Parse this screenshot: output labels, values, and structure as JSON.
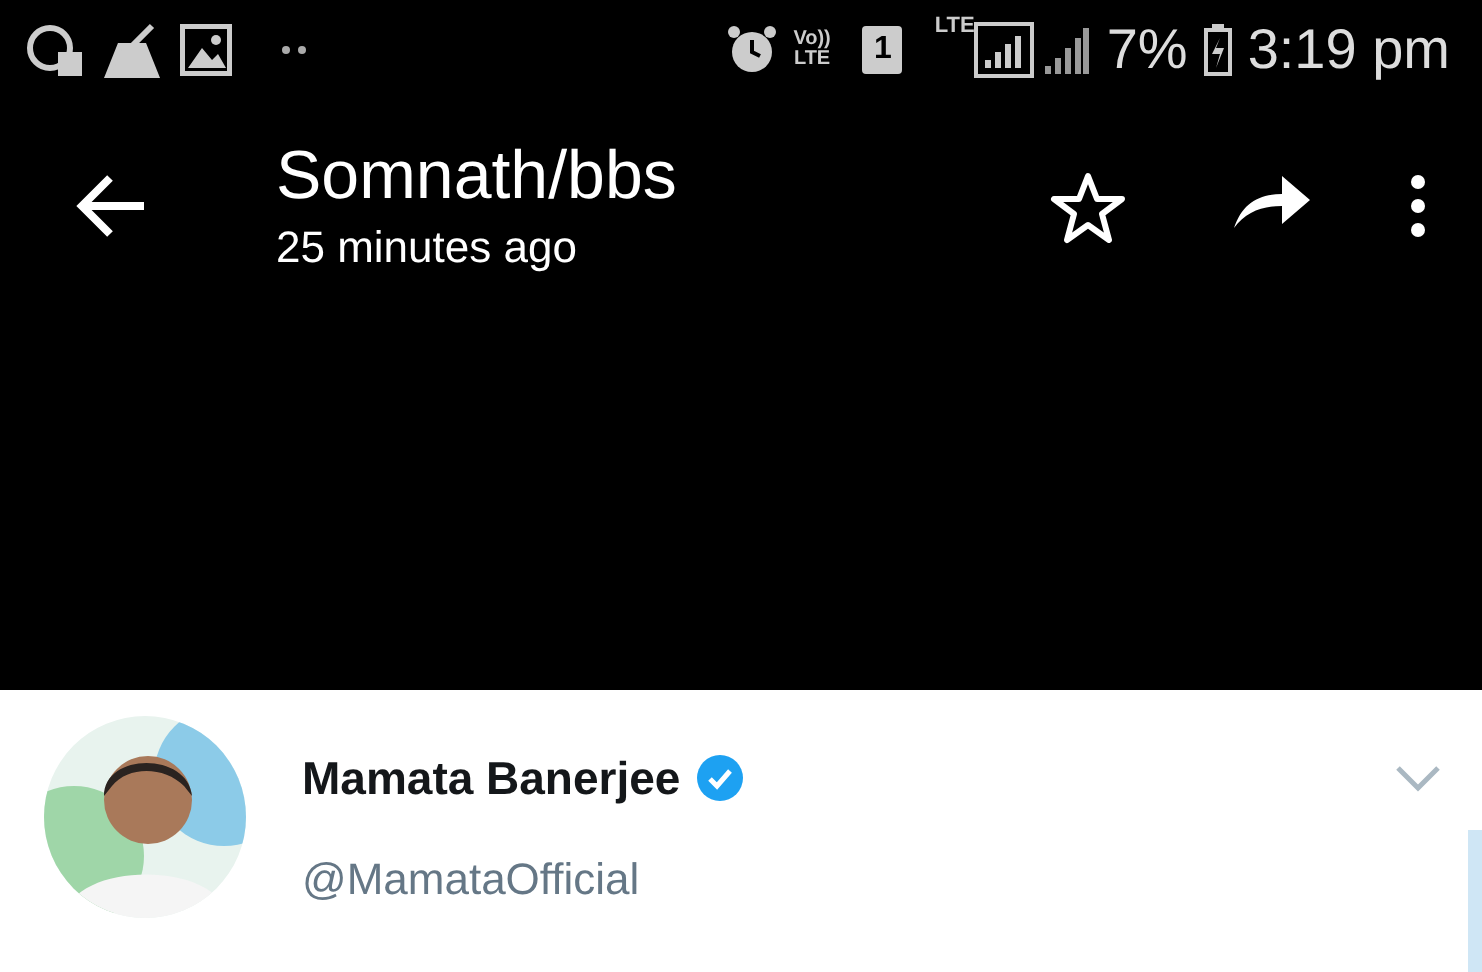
{
  "status_bar": {
    "volte": [
      "Vo))",
      "LTE"
    ],
    "sim_slot": "1",
    "network": "LTE",
    "battery_text": "7%",
    "time": "3:19 pm"
  },
  "toolbar": {
    "title": "Somnath/bbs",
    "subtitle": "25 minutes ago",
    "starred": false
  },
  "tweet": {
    "name": "Mamata Banerjee",
    "verified": true,
    "handle": "@MamataOfficial"
  }
}
